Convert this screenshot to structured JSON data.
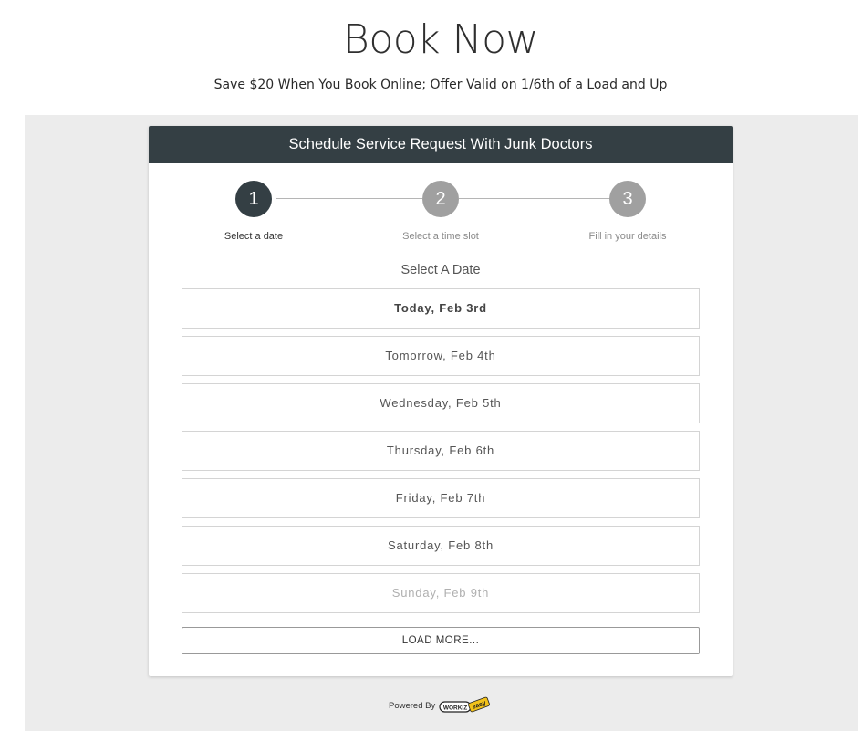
{
  "page": {
    "title": "Book Now",
    "subtitle": "Save $20 When You Book Online; Offer Valid on 1/6th of a Load and Up"
  },
  "card": {
    "header": "Schedule Service Request With Junk Doctors",
    "steps": [
      {
        "number": "1",
        "label": "Select a date",
        "active": true
      },
      {
        "number": "2",
        "label": "Select a time slot",
        "active": false
      },
      {
        "number": "3",
        "label": "Fill in your details",
        "active": false
      }
    ],
    "section_title": "Select A Date",
    "dates": [
      {
        "label": "Today, Feb 3rd"
      },
      {
        "label": "Tomorrow, Feb 4th"
      },
      {
        "label": "Wednesday, Feb 5th"
      },
      {
        "label": "Thursday, Feb 6th"
      },
      {
        "label": "Friday, Feb 7th"
      },
      {
        "label": "Saturday, Feb 8th"
      },
      {
        "label": "Sunday, Feb 9th"
      }
    ],
    "load_more_label": "LOAD MORE..."
  },
  "footer": {
    "powered_by": "Powered By",
    "logo_text": "WORKIZ",
    "logo_tag": "easy"
  },
  "colors": {
    "header_bg": "#343f44",
    "step_active": "#343f44",
    "step_inactive": "#a0a0a0",
    "band_bg": "#ececec",
    "logo_yellow": "#f2c21b"
  }
}
